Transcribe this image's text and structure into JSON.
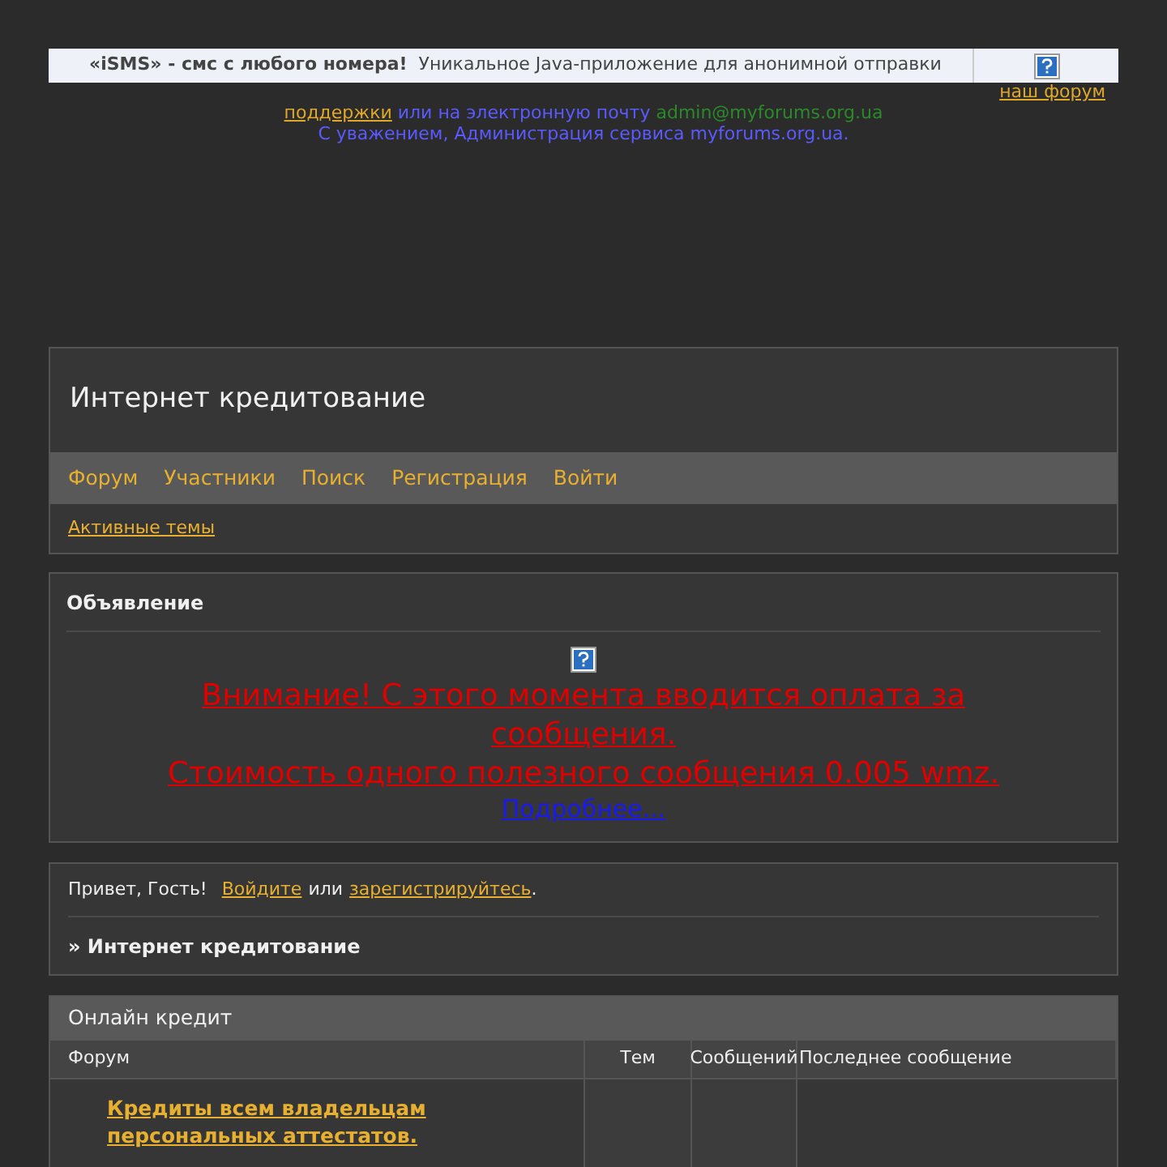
{
  "ad_banner": {
    "title": "«iSMS» - смс с любого номера!",
    "text": "Уникальное Java-приложение для анонимной отправки"
  },
  "notice": {
    "link_1": "наш форум",
    "link_2": "поддержки",
    "text_1": "или на электронную почту",
    "email": "admin@myforums.org.ua",
    "signature": "С уважением, Администрация сервиса myforums.org.ua."
  },
  "header": {
    "title": "Интернет кредитование",
    "nav": [
      "Форум",
      "Участники",
      "Поиск",
      "Регистрация",
      "Войти"
    ],
    "sub_link": "Активные темы"
  },
  "announcement": {
    "title": "Объявление",
    "line_1": "Внимание! С этого момента вводится оплата за сообщения.",
    "line_2": "Стоимость одного полезного сообщения 0.005 wmz.",
    "link": "Подробнее..."
  },
  "welcome": {
    "greeting": "Привет, Гость!",
    "login": "Войдите",
    "or": "или",
    "register": "зарегистрируйтесь",
    "period": ".",
    "breadcrumb": "» Интернет кредитование"
  },
  "category": {
    "title": "Онлайн кредит",
    "columns": [
      "Форум",
      "Тем",
      "Сообщений",
      "Последнее сообщение"
    ],
    "rows": [
      {
        "name": "Кредиты всем владельцам персональных аттестатов."
      }
    ]
  }
}
